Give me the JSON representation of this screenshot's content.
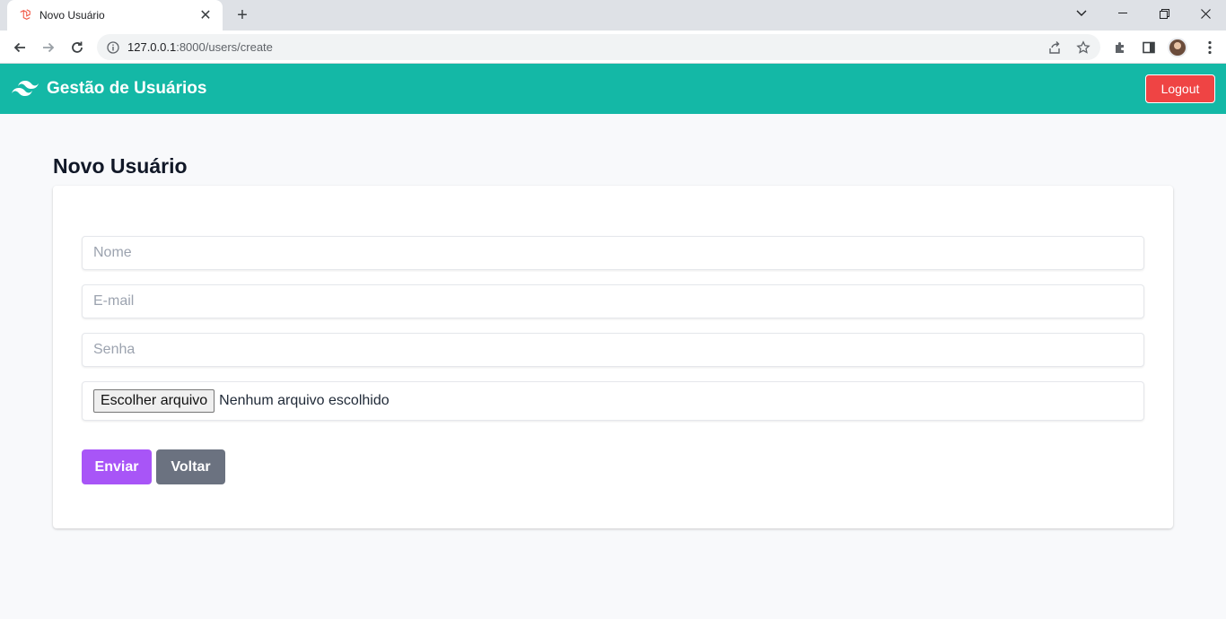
{
  "browser": {
    "tab_title": "Novo Usuário",
    "tab_close": "✕",
    "new_tab": "+",
    "url_host": "127.0.0.1",
    "url_rest": ":8000/users/create"
  },
  "navbar": {
    "brand": "Gestão de Usuários",
    "logout_label": "Logout",
    "bg_color": "#14b8a6",
    "logout_color": "#ef4444"
  },
  "page": {
    "title": "Novo Usuário"
  },
  "form": {
    "name_placeholder": "Nome",
    "email_placeholder": "E-mail",
    "password_placeholder": "Senha",
    "file_button": "Escolher arquivo",
    "file_status": "Nenhum arquivo escolhido",
    "submit_label": "Enviar",
    "back_label": "Voltar",
    "submit_color": "#a855f7",
    "back_color": "#6b7280"
  }
}
